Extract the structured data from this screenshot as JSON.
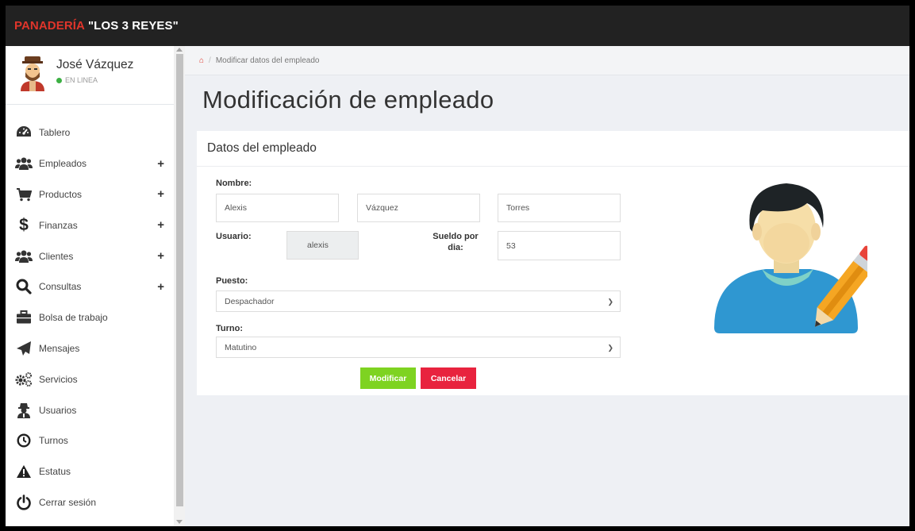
{
  "brand": {
    "name_red": "PANADERÍA",
    "name_white": "\"LOS 3 REYES\""
  },
  "user": {
    "name": "José Vázquez",
    "status": "EN LINEA"
  },
  "sidebar": {
    "items": [
      {
        "label": "Tablero",
        "icon": "dashboard-icon",
        "has_plus": false
      },
      {
        "label": "Empleados",
        "icon": "users-group-icon",
        "has_plus": true
      },
      {
        "label": "Productos",
        "icon": "cart-icon",
        "has_plus": true
      },
      {
        "label": "Finanzas",
        "icon": "dollar-icon",
        "has_plus": true
      },
      {
        "label": "Clientes",
        "icon": "users-group-icon",
        "has_plus": true
      },
      {
        "label": "Consultas",
        "icon": "search-icon",
        "has_plus": true
      },
      {
        "label": "Bolsa de trabajo",
        "icon": "briefcase-icon",
        "has_plus": false
      },
      {
        "label": "Mensajes",
        "icon": "paper-plane-icon",
        "has_plus": false
      },
      {
        "label": "Servicios",
        "icon": "gears-icon",
        "has_plus": false
      },
      {
        "label": "Usuarios",
        "icon": "user-secret-icon",
        "has_plus": false
      },
      {
        "label": "Turnos",
        "icon": "clock-icon",
        "has_plus": false
      },
      {
        "label": "Estatus",
        "icon": "warning-icon",
        "has_plus": false
      },
      {
        "label": "Cerrar sesión",
        "icon": "power-icon",
        "has_plus": false
      }
    ],
    "plus_symbol": "+"
  },
  "breadcrumb": {
    "current": "Modificar datos del empleado"
  },
  "page": {
    "title": "Modificación de empleado"
  },
  "panel": {
    "title": "Datos del empleado"
  },
  "form": {
    "nombre_label": "Nombre:",
    "first_name": "Alexis",
    "last_name_1": "Vázquez",
    "last_name_2": "Torres",
    "usuario_label": "Usuario:",
    "usuario_value": "alexis",
    "sueldo_label": "Sueldo por dia:",
    "sueldo_value": "53",
    "puesto_label": "Puesto:",
    "puesto_value": "Despachador",
    "turno_label": "Turno:",
    "turno_value": "Matutino",
    "submit_label": "Modificar",
    "cancel_label": "Cancelar"
  },
  "colors": {
    "brand_red": "#e0352b",
    "topbar": "#222222",
    "status_online": "#3cb043",
    "btn_modificar": "#7ed321",
    "btn_cancelar": "#e8233e"
  }
}
